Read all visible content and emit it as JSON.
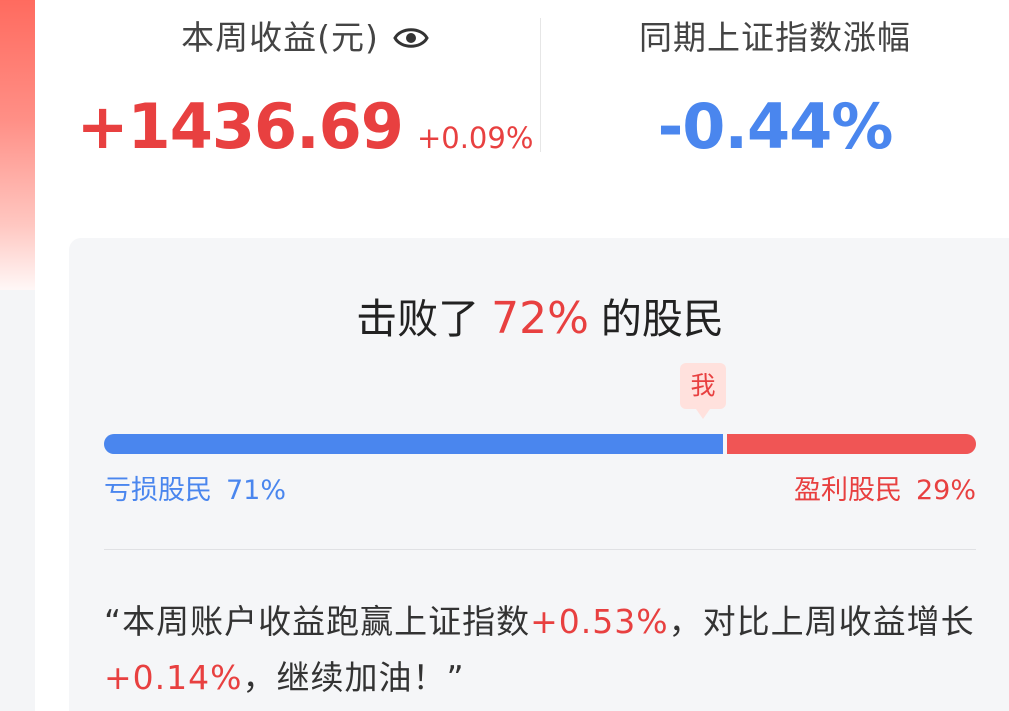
{
  "weekly_income": {
    "label": "本周收益(元)",
    "value": "+1436.69",
    "pct": "+0.09%",
    "eye_icon": "eye-icon"
  },
  "index_change": {
    "label": "同期上证指数涨幅",
    "value": "-0.44%"
  },
  "beat": {
    "prefix": "击败了",
    "pct": "72%",
    "suffix": "的股民"
  },
  "me_tag": "我",
  "distribution": {
    "loss_label": "亏损股民",
    "loss_pct": "71%",
    "loss_fraction": 0.71,
    "gain_label": "盈利股民",
    "gain_pct": "29%"
  },
  "summary": {
    "part1": "“本周账户收益跑赢上证指数",
    "hl1": "+0.53%",
    "part2": "，对比上周收益增长",
    "hl2": "+0.14%",
    "part3": "，继续加油！”"
  },
  "colors": {
    "red": "#e84040",
    "blue": "#4a86ee"
  }
}
